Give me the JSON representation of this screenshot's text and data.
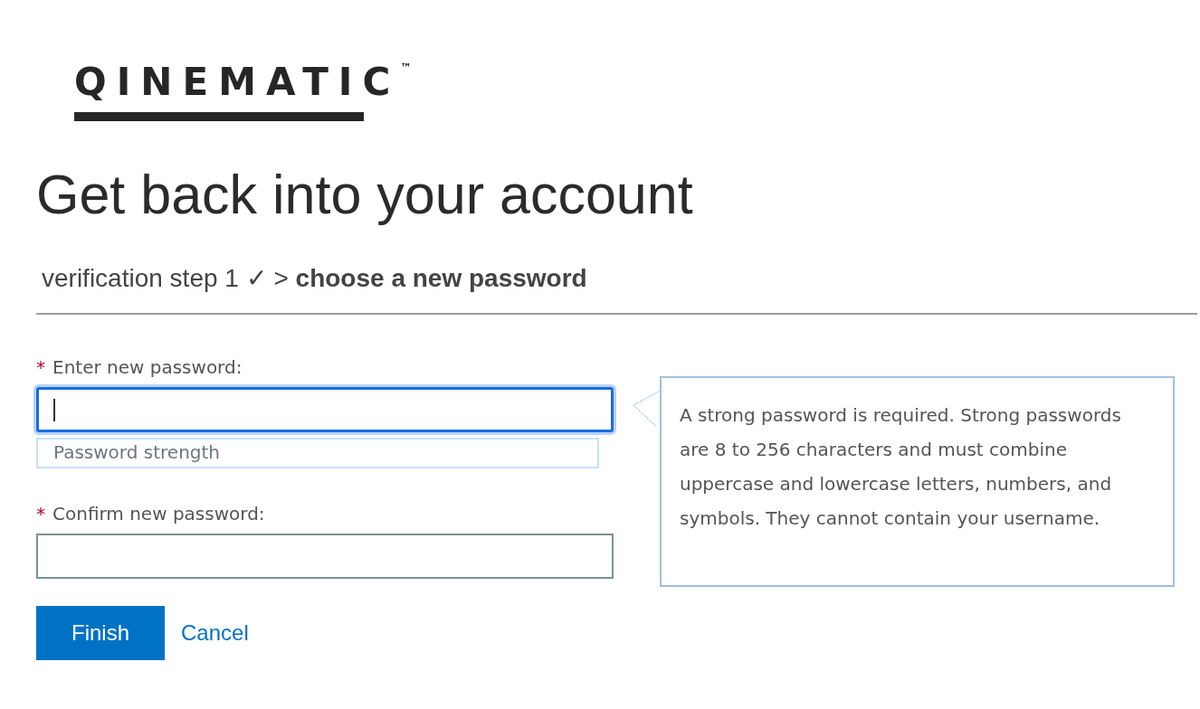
{
  "logo": {
    "text": "QINEMATIC$^{™}$"
  },
  "heading": "Get back into your account",
  "breadcrumb": "verification step 1 ✓ > **choose a new password**",
  "fields": [
    {
      "label": "Enter new password:",
      "required": true,
      "required_mark": "*",
      "focused": true,
      "kind": "password-with-strength",
      "strength_label": "Password strength"
    },
    {
      "label": "Confirm new password:",
      "required": true,
      "required_mark": "*",
      "focused": false,
      "kind": "password"
    }
  ],
  "help": "A strong password is required. Strong passwords are 8 to 256 characters and must combine uppercase and lowercase letters, numbers, and symbols. They cannot contain your username.",
  "buttons": [
    {
      "label": "Finish",
      "kind": "primary"
    },
    {
      "label": "Cancel",
      "kind": "link"
    }
  ]
}
